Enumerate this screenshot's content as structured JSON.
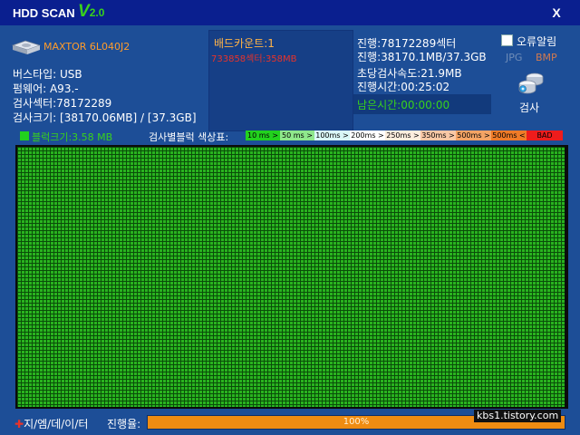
{
  "title_bar": {
    "app_name": "HDD SCAN",
    "version_letter": "V",
    "version_number": "2.0",
    "close_label": "X"
  },
  "drive": {
    "model": "MAXTOR 6L040J2",
    "icon": "hard-drive-icon"
  },
  "info": {
    "bus_type": "버스타입: USB",
    "firmware": "펌웨어: A93.-",
    "scan_sectors": "검사섹터:78172289",
    "scan_size": "검사크기: [38170.06MB] / [37.3GB]"
  },
  "bad": {
    "count": "배드카운트:1",
    "detail": "733858섹터:358MB"
  },
  "progress_info": {
    "sectors": "진행:78172289섹터",
    "size": "진행:38170.1MB/37.3GB",
    "speed": "초당검사속도:21.9MB",
    "elapsed": "진행시간:00:25:02",
    "remaining": "남은시간:00:00:00"
  },
  "options": {
    "error_alarm": "오류알림",
    "jpg": "JPG",
    "bmp": "BMP",
    "scan_label": "검사",
    "scan_icon": "scan-drive-icon"
  },
  "block": {
    "size": "블럭크기:3.58 MB"
  },
  "legend": {
    "label": "검사별블럭 색상표:",
    "items": [
      {
        "label": "10 ms >",
        "color": "#22d11e"
      },
      {
        "label": "50 ms >",
        "color": "#8fe88c"
      },
      {
        "label": "100ms >",
        "color": "#d9f7f7"
      },
      {
        "label": "200ms >",
        "color": "#ffffff"
      },
      {
        "label": "250ms >",
        "color": "#fdeede"
      },
      {
        "label": "350ms >",
        "color": "#f8c8a6"
      },
      {
        "label": "500ms >",
        "color": "#f4a465"
      },
      {
        "label": "500ms <",
        "color": "#ef7b28"
      },
      {
        "label": "BAD",
        "color": "#ee1c1c"
      }
    ]
  },
  "footer": {
    "brand_mark": "✚",
    "brand": "지/엠/데/이/터",
    "progress_label": "진행율:",
    "progress_text": "100%",
    "progress_value": 100,
    "watermark": "kbs1.tistory.com"
  },
  "colors": {
    "accent_green": "#39d21c",
    "progress_orange": "#ef8c12",
    "bad_red": "#e8332a"
  }
}
